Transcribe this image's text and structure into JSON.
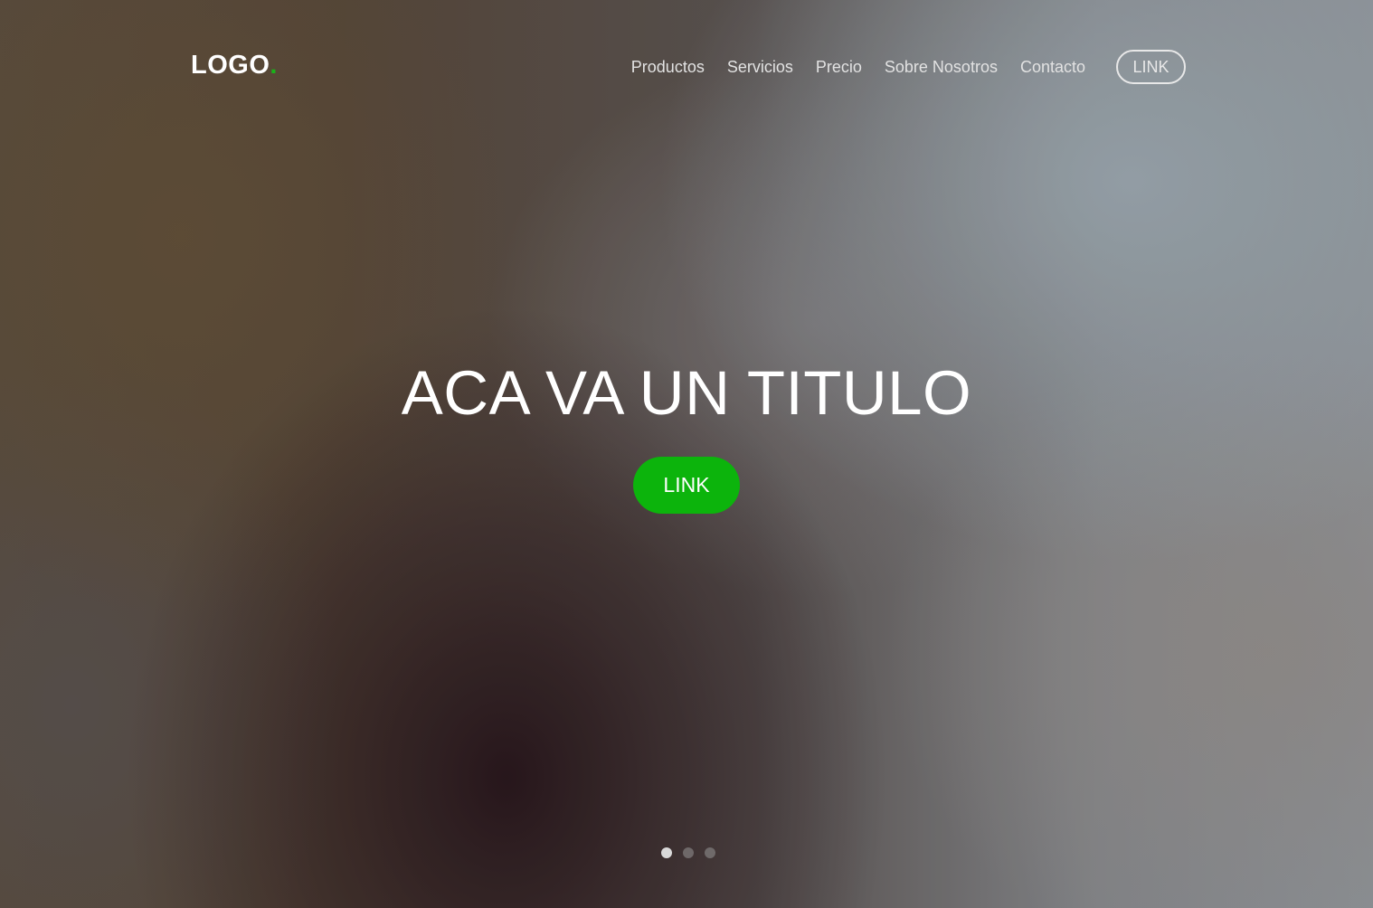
{
  "brand": {
    "logo_text": "LOGO",
    "logo_dot": ".",
    "accent_color": "#19b319"
  },
  "nav": {
    "items": [
      {
        "label": "Productos"
      },
      {
        "label": "Servicios"
      },
      {
        "label": "Precio"
      },
      {
        "label": "Sobre Nosotros"
      },
      {
        "label": "Contacto"
      }
    ],
    "cta_label": "LINK"
  },
  "hero": {
    "title": "ACA VA UN TITULO",
    "cta_label": "LINK",
    "cta_color": "#0cb40c"
  },
  "carousel": {
    "slide_count": 3,
    "active_slide": 1
  }
}
